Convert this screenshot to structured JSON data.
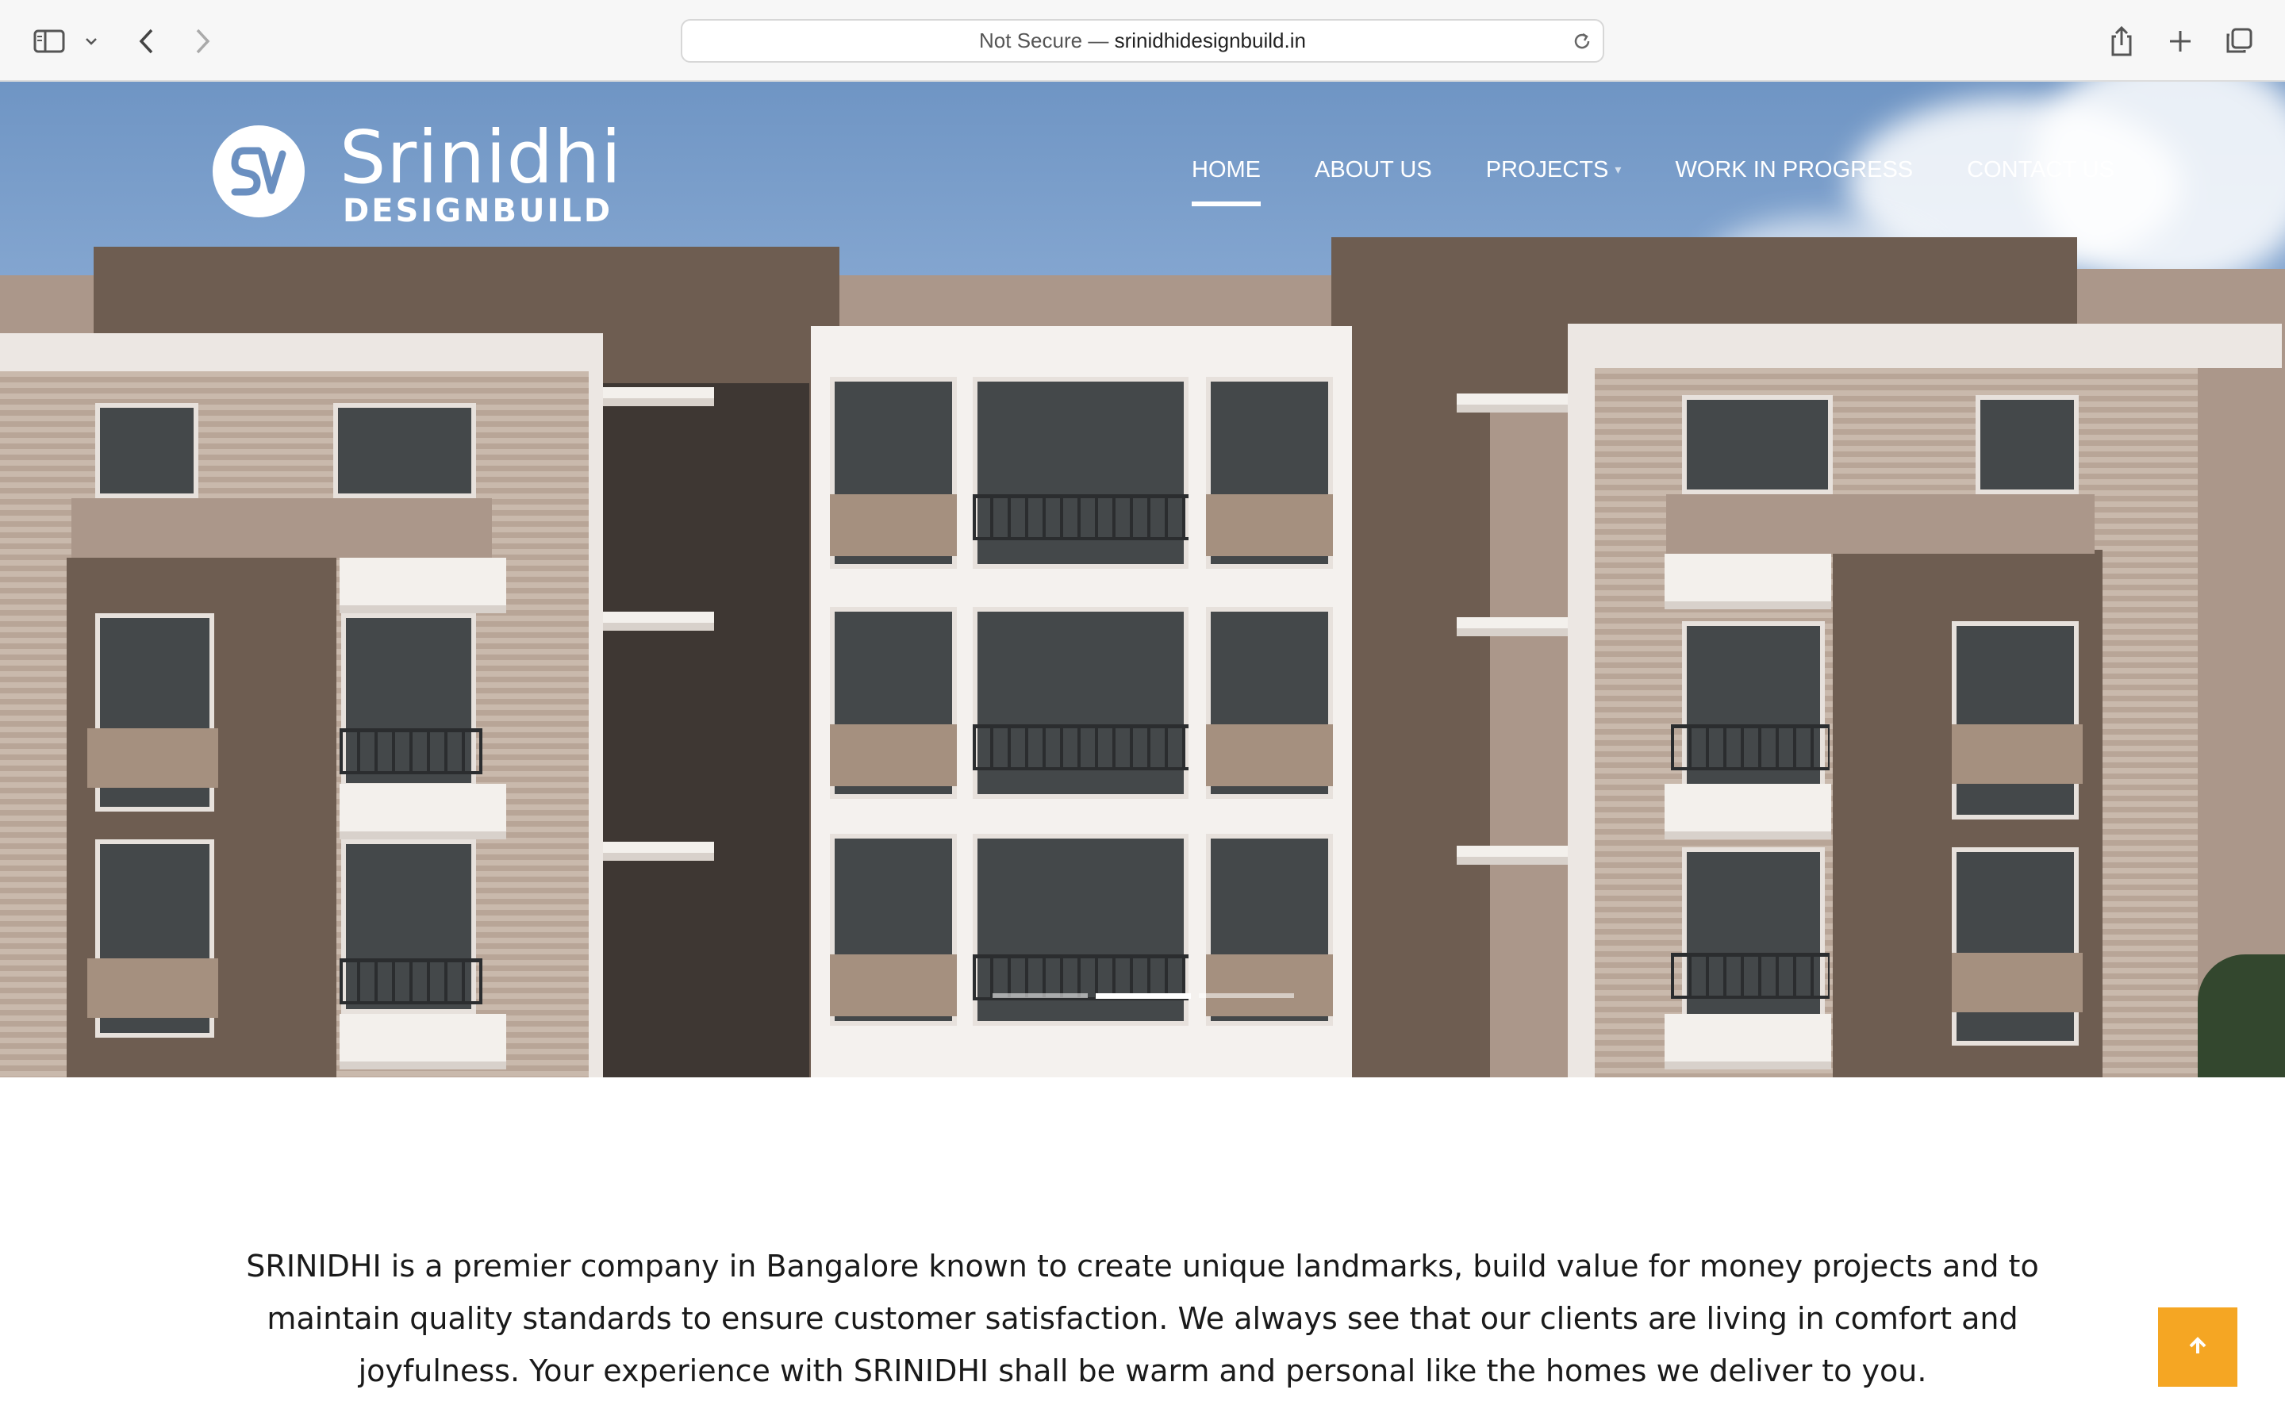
{
  "browser": {
    "address_security": "Not Secure —",
    "address_host": "srinidhidesignbuild.in",
    "icons": [
      "sidebar-icon",
      "chevron-down-icon",
      "back-icon",
      "forward-icon",
      "reload-icon",
      "share-icon",
      "new-tab-icon",
      "tabs-overview-icon"
    ]
  },
  "logo": {
    "emblem": "SV",
    "line1": "Srinidhi",
    "line2": "DESIGNBUILD"
  },
  "nav": {
    "items": [
      {
        "label": "HOME",
        "active": true
      },
      {
        "label": "ABOUT US"
      },
      {
        "label": "PROJECTS",
        "has_dropdown": true
      },
      {
        "label": "WORK IN PROGRESS"
      },
      {
        "label": "CONTACT US"
      }
    ]
  },
  "slider": {
    "slides": 3,
    "active_index": 1
  },
  "intro": {
    "text": "SRINIDHI is a premier company in Bangalore known to create unique landmarks, build value for money projects and to maintain quality standards to ensure customer satisfaction. We always see that our clients are living in comfort and joyfulness. Your experience with SRINIDHI shall be warm and personal like the homes we deliver to you."
  },
  "colors": {
    "accent": "#f5a623",
    "nav_text": "#ffffff",
    "body_text": "#1a1a1a"
  }
}
